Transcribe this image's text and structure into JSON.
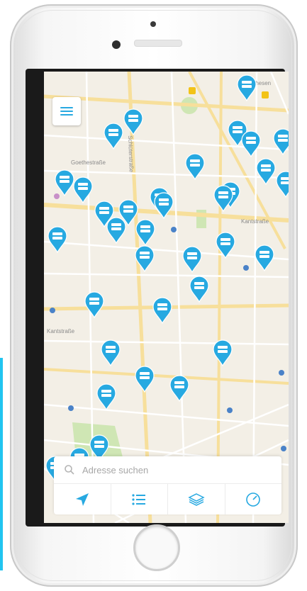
{
  "map": {
    "menu_icon": "hamburger-menu-icon",
    "pin_icon": "car2go-marker-icon",
    "street_labels": [
      "Goethestraße",
      "Kantstraße",
      "Schlüterstraße",
      "Kantstraße",
      "Mathesen"
    ],
    "pin_color": "#27a9e1"
  },
  "search": {
    "placeholder": "Adresse suchen",
    "icon": "search-icon"
  },
  "bottom_nav": [
    {
      "icon": "location-arrow-icon"
    },
    {
      "icon": "list-icon"
    },
    {
      "icon": "layers-icon"
    },
    {
      "icon": "timer-icon"
    }
  ],
  "colors": {
    "accent": "#27a9e1",
    "map_background": "#f3efe6",
    "road_major": "#f7df9b",
    "park": "#cfe6b4"
  }
}
